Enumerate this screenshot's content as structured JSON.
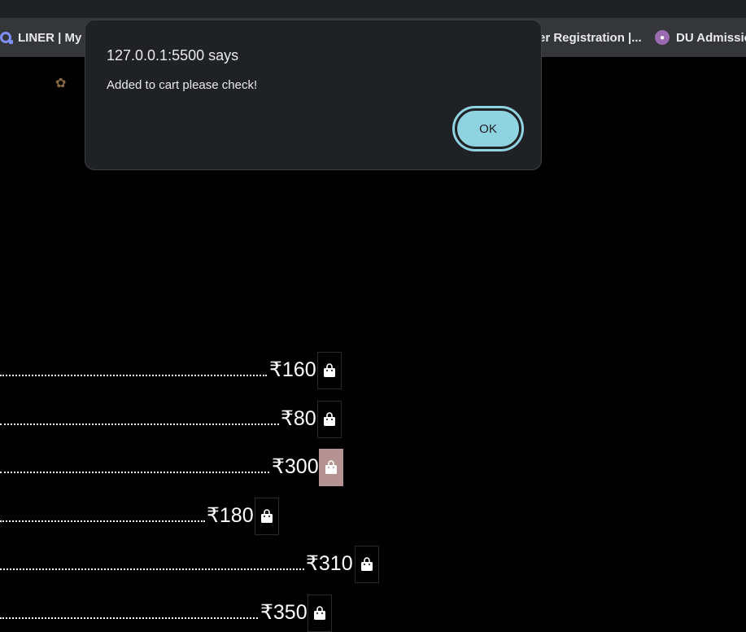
{
  "bookmarks": [
    {
      "label": "LINER | My",
      "icon": "liner-icon"
    },
    {
      "label": "er Registration |...",
      "icon": ""
    },
    {
      "label": "DU Admissio",
      "icon": "du-icon"
    }
  ],
  "alert": {
    "title": "127.0.0.1:5500 says",
    "message": "Added to cart please check!",
    "ok_label": "OK"
  },
  "menu": {
    "decoration_icon": "butterfly-icon",
    "cart_icon": "shopping-bag-icon",
    "items": [
      {
        "price": "₹160"
      },
      {
        "price": "₹80"
      },
      {
        "price": "₹300"
      },
      {
        "price": "₹180"
      },
      {
        "price": "₹310"
      },
      {
        "price": "₹350"
      }
    ]
  },
  "colors": {
    "background": "#000000",
    "dialog_bg": "#202124",
    "ok_button": "#8fd3e0",
    "active_bag": "#b59393"
  }
}
